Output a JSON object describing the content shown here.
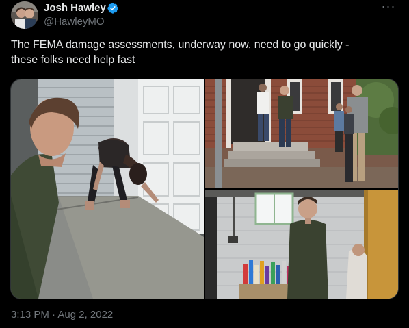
{
  "author": {
    "name": "Josh Hawley",
    "handle": "@HawleyMO",
    "verified_icon": "verified-badge-icon"
  },
  "more_icon": "more-options-icon",
  "more_glyph": "···",
  "tweet": {
    "line1": "The FEMA damage assessments, underway now, need to go quickly -",
    "line2": "these folks need help fast"
  },
  "timestamp": "3:13 PM · Aug 2, 2022",
  "colors": {
    "background": "#000000",
    "text": "#e7e9ea",
    "secondary": "#71767b",
    "verified": "#1d9bf0"
  }
}
